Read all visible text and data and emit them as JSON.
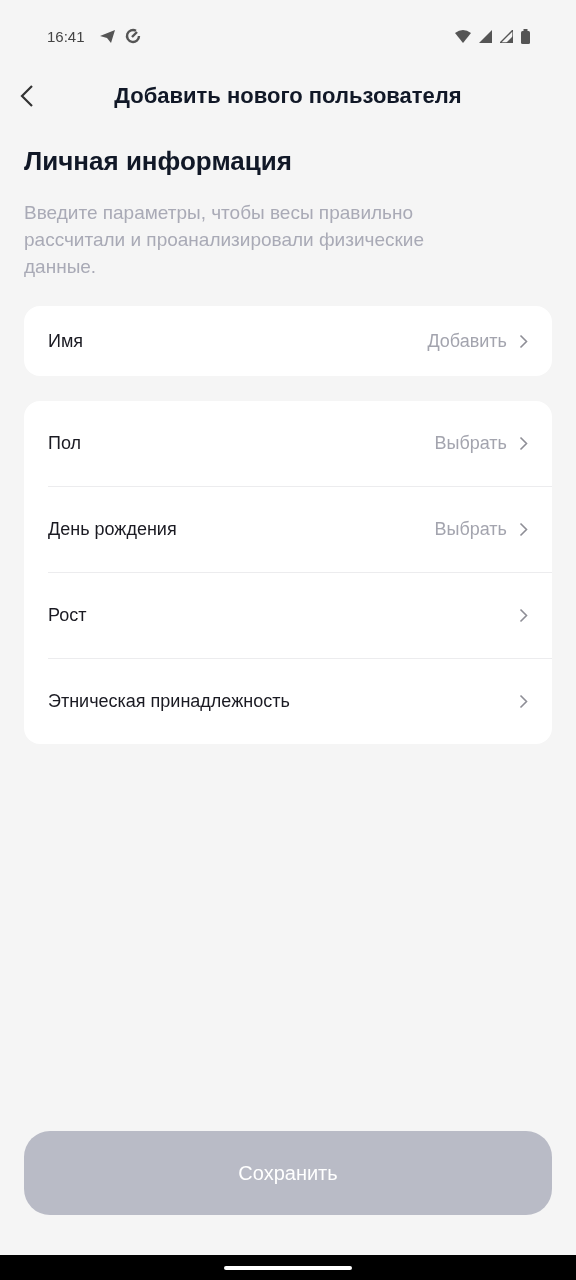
{
  "status_bar": {
    "time": "16:41"
  },
  "header": {
    "title": "Добавить нового пользователя"
  },
  "section_title": "Личная информация",
  "description": "Введите параметры, чтобы весы правильно рассчитали и проанализировали физические данные.",
  "groups": [
    {
      "rows": [
        {
          "label": "Имя",
          "value": "Добавить"
        }
      ]
    },
    {
      "rows": [
        {
          "label": "Пол",
          "value": "Выбрать"
        },
        {
          "label": "День рождения",
          "value": "Выбрать"
        },
        {
          "label": "Рост"
        },
        {
          "label": "Этническая принадлежность"
        }
      ]
    }
  ],
  "save_button": {
    "label": "Сохранить",
    "disabled": true
  }
}
